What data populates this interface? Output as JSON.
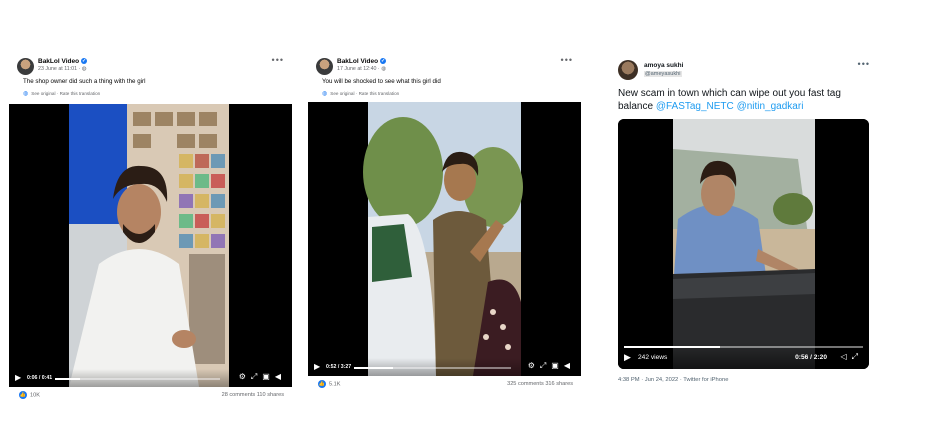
{
  "posts": [
    {
      "author": "BakLol Video",
      "date": "23 June at 11:01 · ",
      "privacy_icon": "globe-icon",
      "text": "The shop owner did such a thing with the girl",
      "translation": "See original · Rate this translation",
      "video_time": "0:06 / 0:41",
      "progress": 0.15,
      "reactions": "10K",
      "stats": "28 comments  110 shares"
    },
    {
      "author": "BakLol Video",
      "date": "17 June at 12:40 · ",
      "privacy_icon": "globe-icon",
      "text": "You will be shocked to see what this girl did",
      "translation": "See original · Rate this translation",
      "video_time": "0:52 / 3:27",
      "progress": 0.25,
      "reactions": "5.1K",
      "stats": "325 comments  316 shares"
    }
  ],
  "tweet": {
    "name": "amoya sukhi",
    "handle": "@ameyasukhi",
    "text": "New scam in town which can wipe out you fast tag balance",
    "mention1": "@FASTag_NETC",
    "mention2": "@nitin_gadkari",
    "views": "242 views",
    "video_time": "0:56 / 2:20",
    "progress": 0.4,
    "meta": "4:38 PM · Jun 24, 2022 · Twitter for iPhone"
  },
  "colors": {
    "facebook_blue": "#1877f2",
    "twitter_blue": "#1d9bf0",
    "video_bg": "#000000"
  }
}
